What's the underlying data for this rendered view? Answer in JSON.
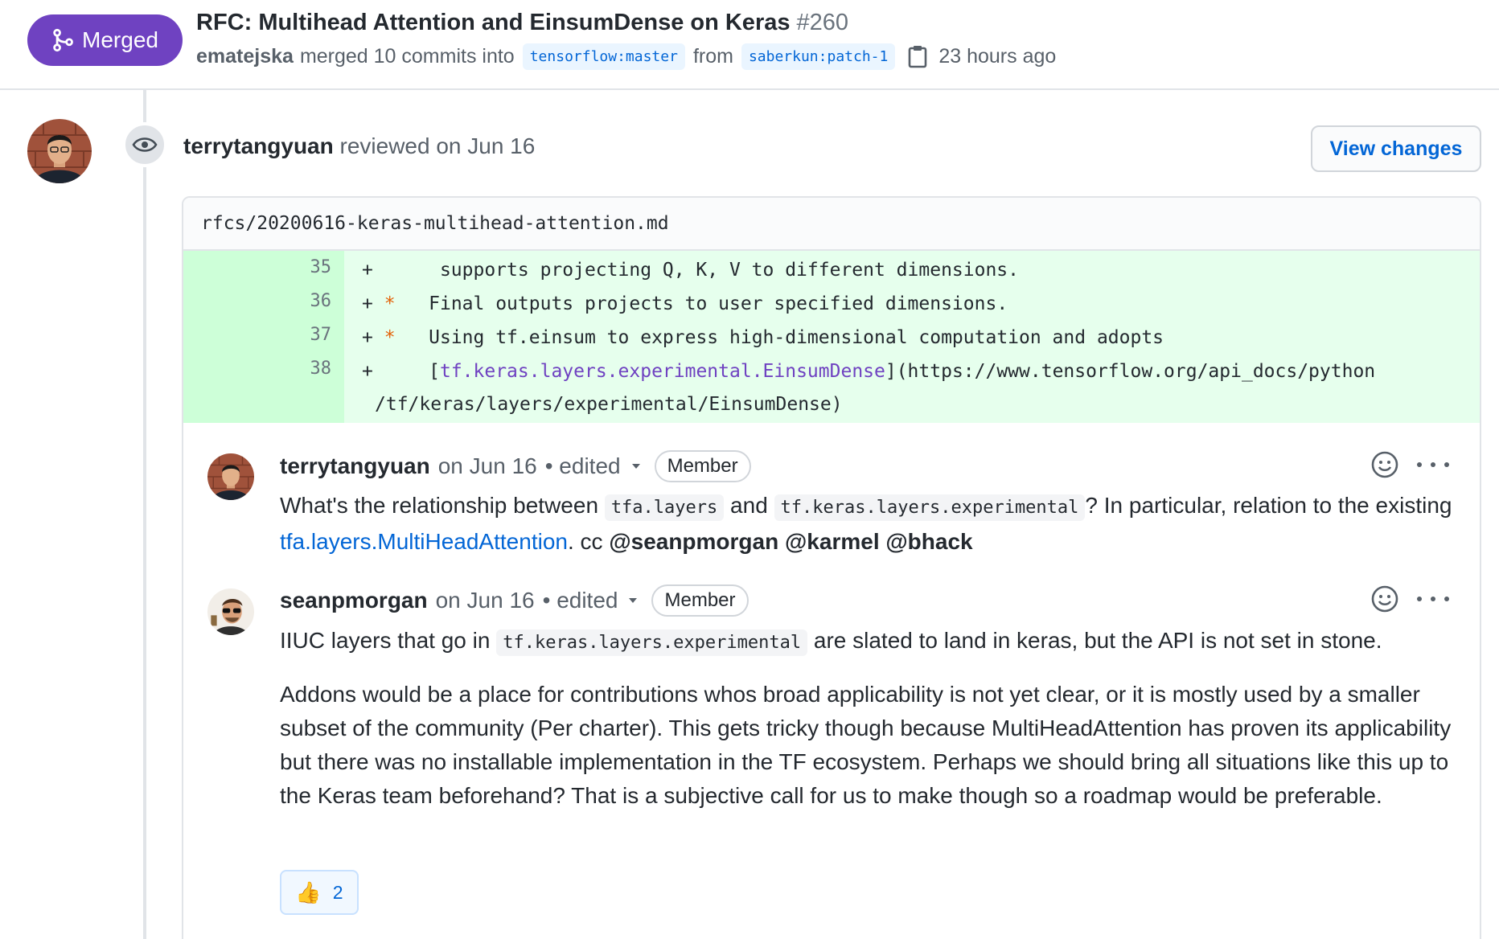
{
  "pr": {
    "status": "Merged",
    "title": "RFC: Multihead Attention and EinsumDense on Keras",
    "number": "#260",
    "merged_by": "ematejska",
    "merged_text": "merged 10 commits into",
    "base_branch": "tensorflow:master",
    "from_text": "from",
    "head_branch": "saberkun:patch-1",
    "time": "23 hours ago",
    "colors": {
      "merged": "#6f42c1",
      "link": "#0366d6",
      "diff_add_bg": "#e6ffed"
    }
  },
  "review": {
    "author": "terrytangyuan",
    "action": "reviewed on Jun 16",
    "view_changes_label": "View changes",
    "file_path": "rfcs/20200616-keras-multihead-attention.md",
    "diff_lines": [
      {
        "num": "35",
        "prefix": "+",
        "bullet": "",
        "text": "    supports projecting Q, K, V to different dimensions."
      },
      {
        "num": "36",
        "prefix": "+",
        "bullet": "*",
        "text": "   Final outputs projects to user specified dimensions."
      },
      {
        "num": "37",
        "prefix": "+",
        "bullet": "*",
        "text": "   Using tf.einsum to express high-dimensional computation and adopts"
      },
      {
        "num": "38",
        "prefix": "+",
        "bullet": "",
        "text_before": "    [",
        "link": "tf.keras.layers.experimental.EinsumDense",
        "text_after": "](https://www.tensorflow.org/api_docs/python"
      }
    ],
    "diff_wrap": "/tf/keras/layers/experimental/EinsumDense)"
  },
  "comments": [
    {
      "author": "terrytangyuan",
      "date": "on Jun 16",
      "edited": "• edited",
      "badge": "Member",
      "body": {
        "t1": "What's the relationship between ",
        "c1": "tfa.layers",
        "t2": " and ",
        "c2": "tf.keras.layers.experimental",
        "t3": "? In particular, relation to the existing ",
        "link": "tfa.layers.MultiHeadAttention",
        "t4": ". cc ",
        "m1": "@seanpmorgan",
        "m2": "@karmel",
        "m3": "@bhack"
      }
    },
    {
      "author": "seanpmorgan",
      "date": "on Jun 16",
      "edited": "• edited",
      "badge": "Member",
      "body": {
        "t1": "IIUC layers that go in ",
        "c1": "tf.keras.layers.experimental",
        "t2": " are slated to land in keras, but the API is not set in stone.",
        "p2": "Addons would be a place for contributions whos broad applicability is not yet clear, or it is mostly used by a smaller subset of the community (Per charter). This gets tricky though because MultiHeadAttention has proven its applicability but there was no installable implementation in the TF ecosystem. Perhaps we should bring all situations like this up to the Keras team beforehand? That is a subjective call for us to make though so a roadmap would be preferable."
      },
      "reaction": {
        "emoji": "thumbs-up",
        "count": "2"
      }
    }
  ]
}
